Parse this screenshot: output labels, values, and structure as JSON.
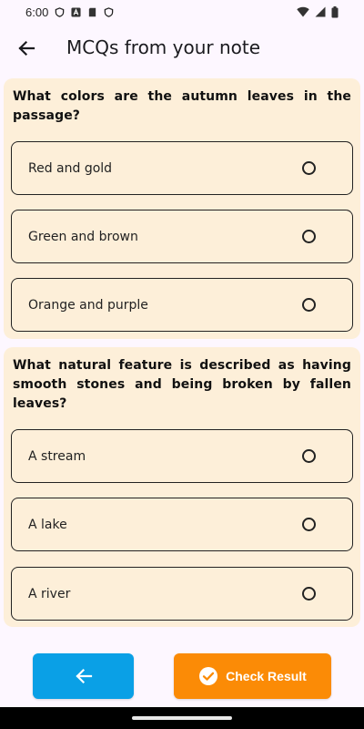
{
  "status_bar": {
    "time": "6:00",
    "left_icons": [
      "shield-icon",
      "a-notification-icon",
      "sd-card-icon",
      "shield-icon"
    ],
    "right_icons": [
      "wifi-icon",
      "signal-icon",
      "battery-icon"
    ]
  },
  "app_bar": {
    "back_icon": "arrow-left-icon",
    "title": "MCQs from your note"
  },
  "questions": [
    {
      "text": "What colors are the autumn leaves in the passage?",
      "options": [
        "Red and gold",
        "Green and brown",
        "Orange and purple"
      ]
    },
    {
      "text": "What natural feature is described as having smooth stones and being broken by fallen leaves?",
      "options": [
        "A stream",
        "A lake",
        "A river"
      ]
    }
  ],
  "bottom": {
    "prev_icon": "arrow-left-icon",
    "check_icon": "check-circle-icon",
    "check_label": "Check Result"
  },
  "colors": {
    "background": "#fdf7ff",
    "card": "#fdefd9",
    "prev_button": "#0aa0e6",
    "check_button": "#fb8b06"
  }
}
